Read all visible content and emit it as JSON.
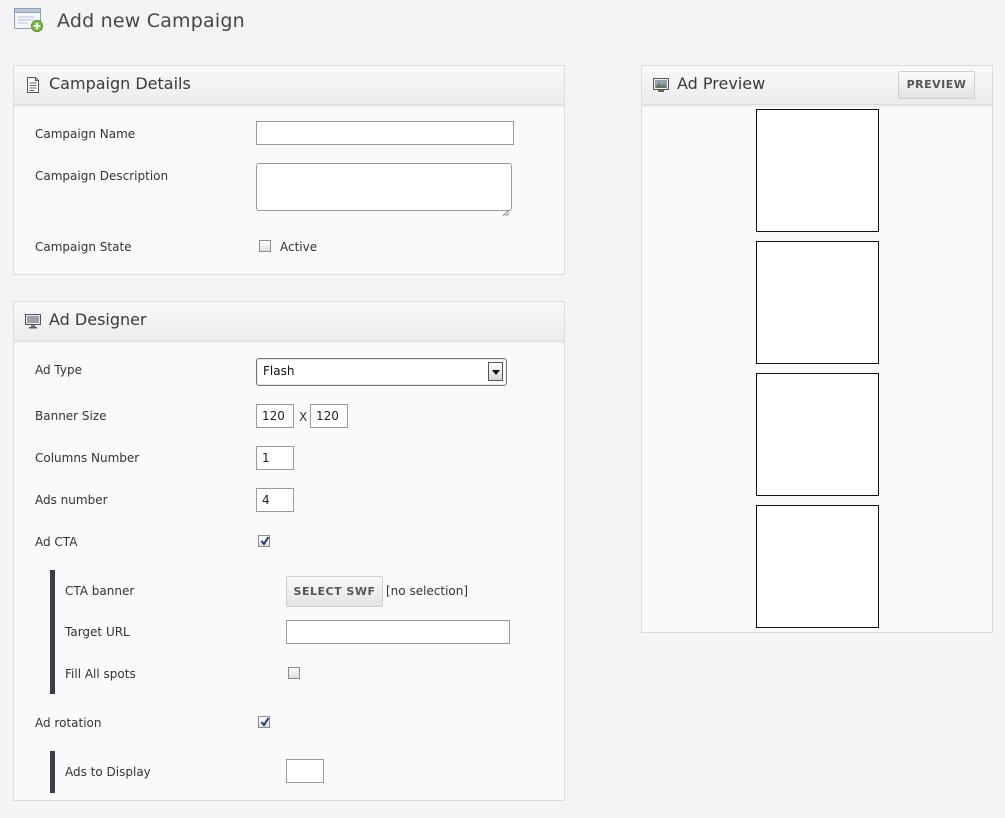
{
  "page": {
    "title": "Add new Campaign",
    "icon": "add-campaign-icon"
  },
  "campaign_details": {
    "title": "Campaign Details",
    "icon": "document-icon",
    "name_label": "Campaign Name",
    "name_value": "",
    "description_label": "Campaign Description",
    "description_value": "",
    "state_label": "Campaign State",
    "active_label": "Active",
    "active_checked": false
  },
  "ad_designer": {
    "title": "Ad Designer",
    "icon": "monitor-icon",
    "ad_type_label": "Ad Type",
    "ad_type_value": "Flash",
    "banner_size_label": "Banner Size",
    "banner_width": "120",
    "banner_separator": "X",
    "banner_height": "120",
    "columns_label": "Columns Number",
    "columns_value": "1",
    "ads_number_label": "Ads number",
    "ads_number_value": "4",
    "ad_cta_label": "Ad CTA",
    "ad_cta_checked": true,
    "cta_banner_label": "CTA banner",
    "select_swf_label": "SELECT SWF",
    "selection_text": "[no selection]",
    "target_url_label": "Target URL",
    "target_url_value": "",
    "fill_all_label": "Fill All spots",
    "fill_all_checked": false,
    "ad_rotation_label": "Ad rotation",
    "ad_rotation_checked": true,
    "ads_to_display_label": "Ads to Display",
    "ads_to_display_value": ""
  },
  "ad_preview": {
    "title": "Ad Preview",
    "icon": "preview-icon",
    "preview_button": "PREVIEW",
    "slot_count": 4
  },
  "colors": {
    "background": "#f4f4f4",
    "panel": "#fafafa",
    "accent_bar": "#3c3c48"
  }
}
